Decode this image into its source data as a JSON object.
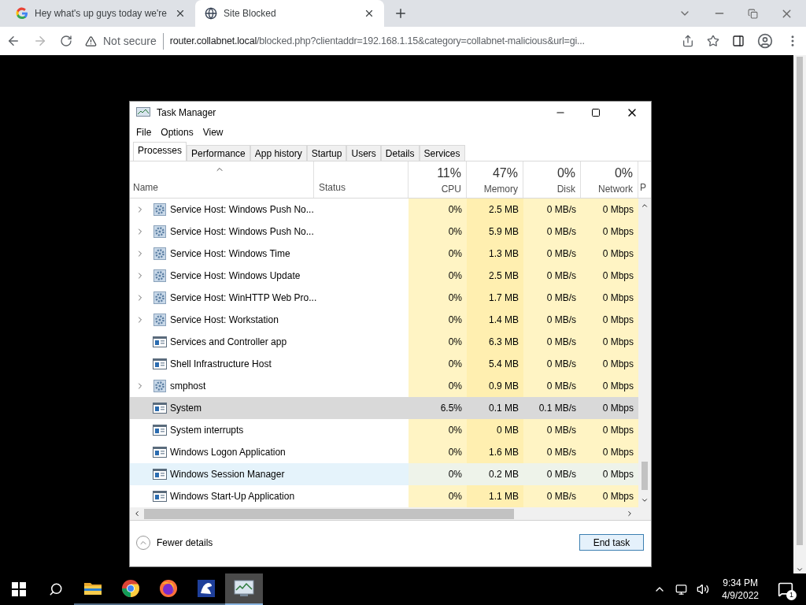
{
  "browser": {
    "tabs": [
      {
        "title": "Hey what's up guys today we're",
        "selected": false,
        "kind": "google"
      },
      {
        "title": "Site Blocked",
        "selected": true,
        "kind": "globe"
      }
    ],
    "security": "Not secure",
    "url_host": "router.collabnet.local",
    "url_path": "/blocked.php?clientaddr=192.168.1.15&category=collabnet-malicious&url=gi..."
  },
  "window": {
    "title": "Task Manager",
    "menu": [
      "File",
      "Options",
      "View"
    ],
    "tabs": [
      {
        "label": "Processes",
        "selected": true
      },
      {
        "label": "Performance",
        "selected": false
      },
      {
        "label": "App history",
        "selected": false
      },
      {
        "label": "Startup",
        "selected": false
      },
      {
        "label": "Users",
        "selected": false
      },
      {
        "label": "Details",
        "selected": false
      },
      {
        "label": "Services",
        "selected": false
      }
    ],
    "columns": [
      {
        "label": "Name"
      },
      {
        "label": "Status"
      },
      {
        "total": "11%",
        "label": "CPU"
      },
      {
        "total": "47%",
        "label": "Memory"
      },
      {
        "total": "0%",
        "label": "Disk"
      },
      {
        "total": "0%",
        "label": "Network"
      },
      {
        "label": "P"
      }
    ],
    "rows": [
      {
        "name": "Service Host: Windows Push No...",
        "kind": "service",
        "expandable": true,
        "selected": false,
        "hovered": false,
        "cpu": "0%",
        "memory": "2.5 MB",
        "disk": "0 MB/s",
        "network": "0 Mbps"
      },
      {
        "name": "Service Host: Windows Push No...",
        "kind": "service",
        "expandable": true,
        "selected": false,
        "hovered": false,
        "cpu": "0%",
        "memory": "5.9 MB",
        "disk": "0 MB/s",
        "network": "0 Mbps"
      },
      {
        "name": "Service Host: Windows Time",
        "kind": "service",
        "expandable": true,
        "selected": false,
        "hovered": false,
        "cpu": "0%",
        "memory": "1.3 MB",
        "disk": "0 MB/s",
        "network": "0 Mbps"
      },
      {
        "name": "Service Host: Windows Update",
        "kind": "service",
        "expandable": true,
        "selected": false,
        "hovered": false,
        "cpu": "0%",
        "memory": "2.5 MB",
        "disk": "0 MB/s",
        "network": "0 Mbps"
      },
      {
        "name": "Service Host: WinHTTP Web Pro...",
        "kind": "service",
        "expandable": true,
        "selected": false,
        "hovered": false,
        "cpu": "0%",
        "memory": "1.7 MB",
        "disk": "0 MB/s",
        "network": "0 Mbps"
      },
      {
        "name": "Service Host: Workstation",
        "kind": "service",
        "expandable": true,
        "selected": false,
        "hovered": false,
        "cpu": "0%",
        "memory": "1.4 MB",
        "disk": "0 MB/s",
        "network": "0 Mbps"
      },
      {
        "name": "Services and Controller app",
        "kind": "app",
        "expandable": false,
        "selected": false,
        "hovered": false,
        "cpu": "0%",
        "memory": "6.3 MB",
        "disk": "0 MB/s",
        "network": "0 Mbps"
      },
      {
        "name": "Shell Infrastructure Host",
        "kind": "app",
        "expandable": false,
        "selected": false,
        "hovered": false,
        "cpu": "0%",
        "memory": "5.4 MB",
        "disk": "0 MB/s",
        "network": "0 Mbps"
      },
      {
        "name": "smphost",
        "kind": "service",
        "expandable": true,
        "selected": false,
        "hovered": false,
        "cpu": "0%",
        "memory": "0.9 MB",
        "disk": "0 MB/s",
        "network": "0 Mbps"
      },
      {
        "name": "System",
        "kind": "app",
        "expandable": false,
        "selected": true,
        "hovered": false,
        "cpu": "6.5%",
        "memory": "0.1 MB",
        "disk": "0.1 MB/s",
        "network": "0 Mbps"
      },
      {
        "name": "System interrupts",
        "kind": "app",
        "expandable": false,
        "selected": false,
        "hovered": false,
        "cpu": "0%",
        "memory": "0 MB",
        "disk": "0 MB/s",
        "network": "0 Mbps"
      },
      {
        "name": "Windows Logon Application",
        "kind": "app",
        "expandable": false,
        "selected": false,
        "hovered": false,
        "cpu": "0%",
        "memory": "1.6 MB",
        "disk": "0 MB/s",
        "network": "0 Mbps"
      },
      {
        "name": "Windows Session Manager",
        "kind": "app",
        "expandable": false,
        "selected": false,
        "hovered": true,
        "cpu": "0%",
        "memory": "0.2 MB",
        "disk": "0 MB/s",
        "network": "0 Mbps"
      },
      {
        "name": "Windows Start-Up Application",
        "kind": "app",
        "expandable": false,
        "selected": false,
        "hovered": false,
        "cpu": "0%",
        "memory": "1.1 MB",
        "disk": "0 MB/s",
        "network": "0 Mbps"
      }
    ],
    "fewer_details": "Fewer details",
    "end_task": "End task"
  },
  "taskbar": {
    "apps": [
      {
        "kind": "explorer",
        "active": false
      },
      {
        "kind": "chrome",
        "active": false
      },
      {
        "kind": "firefox",
        "active": false
      },
      {
        "kind": "frog",
        "active": false
      },
      {
        "kind": "taskmgr",
        "active": true
      }
    ],
    "time": "9:34 PM",
    "date": "4/9/2022",
    "notifications": "1"
  }
}
